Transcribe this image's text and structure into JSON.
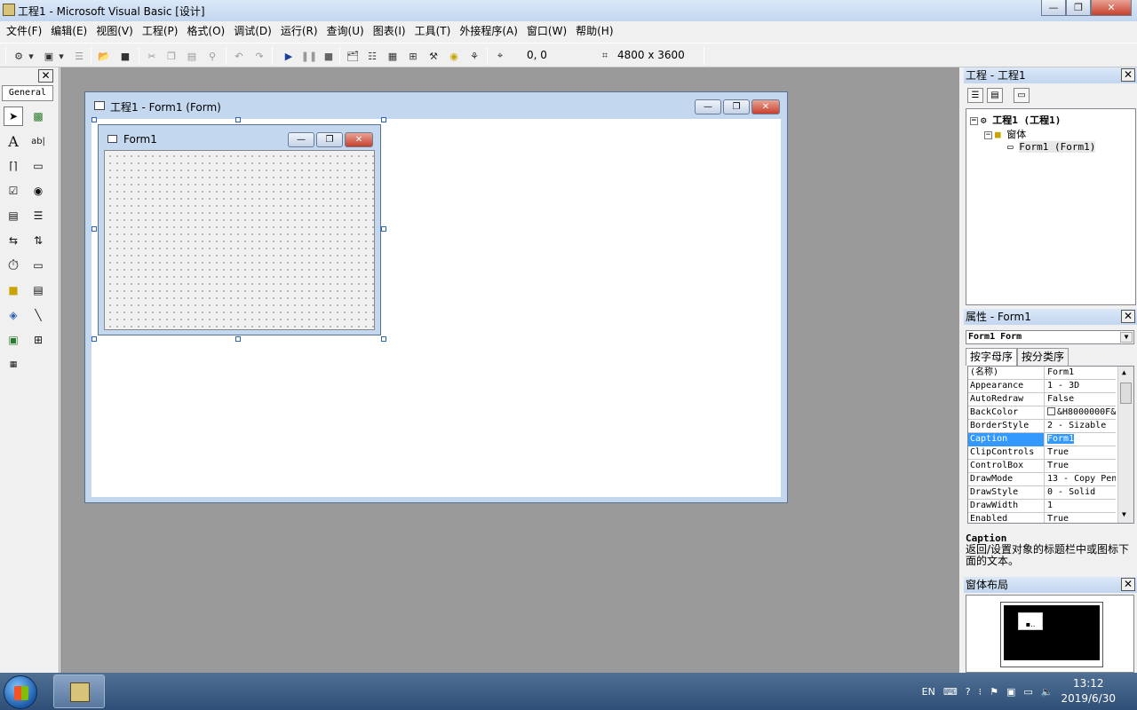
{
  "window": {
    "title": "工程1 - Microsoft Visual Basic [设计]",
    "minimize": "—",
    "restore": "❐",
    "close": "✕"
  },
  "menu": [
    "文件(F)",
    "编辑(E)",
    "视图(V)",
    "工程(P)",
    "格式(O)",
    "调试(D)",
    "运行(R)",
    "查询(U)",
    "图表(I)",
    "工具(T)",
    "外接程序(A)",
    "窗口(W)",
    "帮助(H)"
  ],
  "toolbar": {
    "position": "0, 0",
    "size": "4800 x 3600"
  },
  "toolbox": {
    "tab": "General",
    "close": "✕"
  },
  "designer": {
    "title": "工程1 - Form1 (Form)",
    "form_caption": "Form1"
  },
  "project": {
    "title": "工程 - 工程1",
    "close": "✕",
    "root": "工程1 (工程1)",
    "folder": "窗体",
    "item": "Form1 (Form1)"
  },
  "properties": {
    "title": "属性 - Form1",
    "close": "✕",
    "object": "Form1 Form",
    "tab_alpha": "按字母序",
    "tab_category": "按分类序",
    "rows": [
      {
        "name": "(名称)",
        "value": "Form1"
      },
      {
        "name": "Appearance",
        "value": "1 - 3D"
      },
      {
        "name": "AutoRedraw",
        "value": "False"
      },
      {
        "name": "BackColor",
        "value": "&H8000000F&"
      },
      {
        "name": "BorderStyle",
        "value": "2 - Sizable"
      },
      {
        "name": "Caption",
        "value": "Form1"
      },
      {
        "name": "ClipControls",
        "value": "True"
      },
      {
        "name": "ControlBox",
        "value": "True"
      },
      {
        "name": "DrawMode",
        "value": "13 - Copy Pen"
      },
      {
        "name": "DrawStyle",
        "value": "0 - Solid"
      },
      {
        "name": "DrawWidth",
        "value": "1"
      },
      {
        "name": "Enabled",
        "value": "True"
      }
    ],
    "desc_name": "Caption",
    "desc_text": "返回/设置对象的标题栏中或图标下面的文本。"
  },
  "layout_panel": {
    "title": "窗体布局",
    "close": "✕"
  },
  "taskbar": {
    "lang": "EN",
    "time": "13:12",
    "date": "2019/6/30"
  },
  "colors": {
    "titlebar": "#c2d6ef",
    "mdi_background": "#9a9a9a",
    "selection": "#3399ff"
  }
}
